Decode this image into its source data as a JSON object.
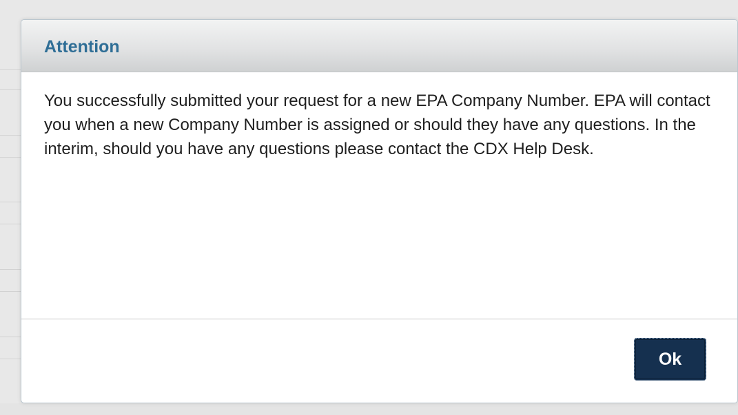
{
  "dialog": {
    "title": "Attention",
    "message": "You successfully submitted your request for a new EPA Company Number. EPA will contact you when a new Company Number is assigned or should they have any questions. In the interim, should you have any questions please contact the CDX Help Desk.",
    "ok_label": "Ok"
  },
  "colors": {
    "title_text": "#2f6e96",
    "button_background": "#15304f",
    "button_text": "#ffffff"
  }
}
